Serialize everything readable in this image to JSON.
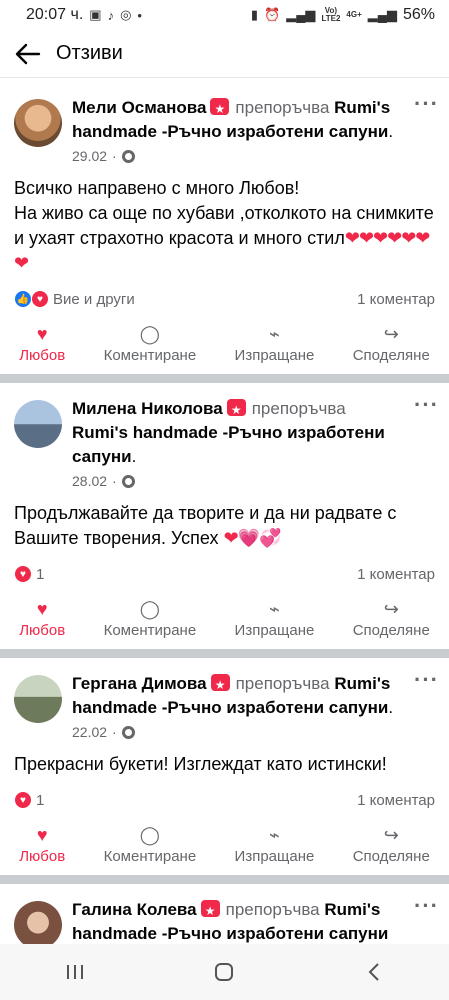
{
  "status": {
    "time": "20:07 ч.",
    "battery": "56%",
    "network": "4G+"
  },
  "header": {
    "title": "Отзиви",
    "back_icon": "arrow-left-icon"
  },
  "posts": [
    {
      "author": "Мели Османова",
      "verb": "препоръчва",
      "page": "Rumi's handmade -Ръчно изработени сапуни",
      "date": "29.02",
      "body": "Всичко направено с много Любов!\nНа живо са още по хубави ,отколкото на снимките и ухаят страхотно красота и много стил",
      "emoji": "❤❤❤❤❤❤❤",
      "reactions": "Вие и други",
      "comments": "1 коментар",
      "avatar_color": "#c88a5c"
    },
    {
      "author": "Милена Николова",
      "verb": "препоръчва",
      "page": "Rumi's handmade -Ръчно изработени сапуни",
      "date": "28.02",
      "body": "Продължавайте да творите и да ни радвате с Вашите творения. Успех",
      "emoji": "❤💗💞",
      "reactions": "1",
      "comments": "1 коментар",
      "avatar_color": "#6b8fb4"
    },
    {
      "author": "Гергана Димова",
      "verb": "препоръчва",
      "page": "Rumi's handmade -Ръчно изработени сапуни",
      "date": "22.02",
      "body": "Прекрасни букети! Изглеждат като истински!",
      "emoji": "",
      "reactions": "1",
      "comments": "1 коментар",
      "avatar_color": "#7a8a6a"
    },
    {
      "author": "Галина Колева",
      "verb": "препоръчва",
      "page": "Rumi's handmade -Ръчно изработени сапуни",
      "avatar_color": "#8a6a5a"
    }
  ],
  "actions": {
    "love": "Любов",
    "comment": "Коментиране",
    "send": "Изпращане",
    "share": "Споделяне"
  },
  "colors": {
    "accent_red": "#f02849",
    "like_blue": "#1877f2",
    "muted": "#65676b"
  }
}
